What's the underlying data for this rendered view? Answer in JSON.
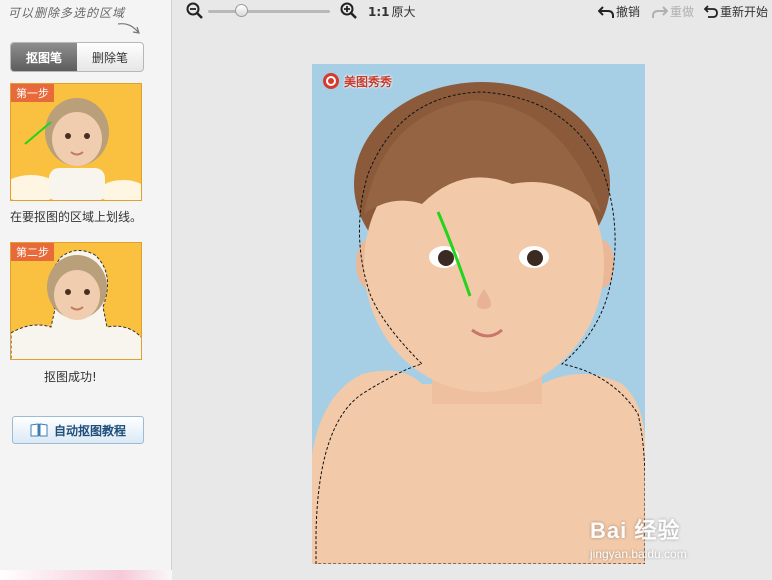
{
  "sidebar": {
    "hint": "可以删除多选的区域",
    "tabs": [
      {
        "label": "抠图笔",
        "active": true
      },
      {
        "label": "删除笔",
        "active": false
      }
    ],
    "steps": [
      {
        "badge": "第一步",
        "caption": "在要抠图的区域上划线。"
      },
      {
        "badge": "第二步",
        "caption": "抠图成功!"
      }
    ],
    "tutorial_button": "自动抠图教程"
  },
  "toolbar": {
    "zoom_ratio": "1:1",
    "original_size": "原大",
    "undo": "撤销",
    "redo": "重做",
    "restart": "重新开始",
    "zoom_level_fraction": 0.25
  },
  "canvas": {
    "logo_text": "美图秀秀",
    "background_color": "#a6cfe6",
    "stroke_color": "#22d41e"
  },
  "watermark": {
    "main": "Bai 经验",
    "sub": "jingyan.baidu.com"
  }
}
